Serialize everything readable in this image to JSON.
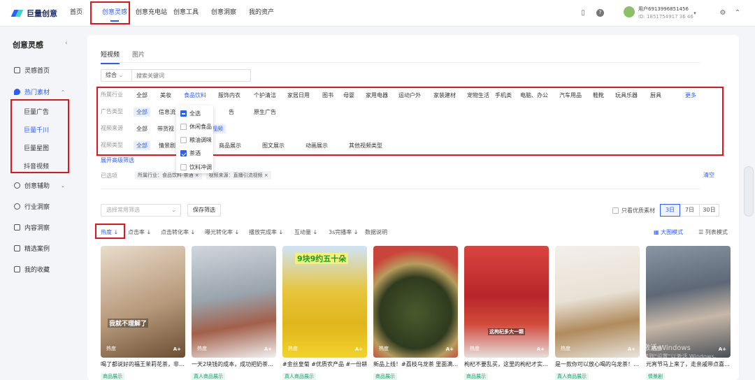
{
  "header": {
    "logo_text": "巨量创意",
    "nav": [
      "首页",
      "创意灵感",
      "创意充电站",
      "创意工具",
      "创意洞察",
      "我的资产"
    ],
    "user_name": "用户6913996851456",
    "user_id": "ID: 1851754917 36 46",
    "icons": [
      "phone-icon",
      "help-icon",
      "settings-icon"
    ]
  },
  "sidebar": {
    "title": "创意灵感",
    "items": [
      "灵感首页",
      "热门素材",
      "创意辅助",
      "行业洞察",
      "内容洞察",
      "精选案例",
      "我的收藏"
    ],
    "sub_items": [
      "巨量广告",
      "巨量千川",
      "巨量星图",
      "抖音视频"
    ]
  },
  "main": {
    "tabs": [
      "短视频",
      "图片"
    ],
    "search_select": "综合",
    "search_placeholder": "搜索关键词",
    "filters": {
      "industry_label": "所属行业",
      "industry": [
        "全部",
        "美妆",
        "食品饮料",
        "服饰内衣",
        "个护清洁",
        "家居日用",
        "图书",
        "母婴",
        "家用电器",
        "运动户外",
        "家装建材",
        "宠物生活",
        "手机类",
        "电脑、办公",
        "汽车用品",
        "鞋靴",
        "玩具乐器",
        "厨具",
        "更多"
      ],
      "adtype_label": "广告类型",
      "adtype": [
        "全部",
        "信息流",
        "告",
        "原生广告"
      ],
      "source_label": "视频来源",
      "source": [
        "全部",
        "带货视",
        "引流视频"
      ],
      "videotype_label": "视频类型",
      "videotype": [
        "全部",
        "情景剧",
        "商品展示",
        "图文展示",
        "动画展示",
        "其他视频类型"
      ]
    },
    "dropdown": [
      "全选",
      "休闲食品",
      "粮油调味",
      "茶酒",
      "饮料冲调"
    ],
    "expand_link": "展开高级筛选",
    "selected_label": "已选项",
    "selected_tags": [
      "所属行业：食品饮料-茶酒 ×",
      "视频来源：直播引流视频 ×"
    ],
    "clear": "清空",
    "common_filter_placeholder": "选择常用筛选",
    "save_filter": "保存筛选",
    "quality_only": "只看优质素材",
    "days": [
      "3日",
      "7日",
      "30日"
    ],
    "sorts": [
      "热度 ↓",
      "点击率 ↓",
      "点击转化率 ↓",
      "曝光转化率 ↓",
      "播放完成率 ↓",
      "互动量 ↓",
      "3s完播率 ↓",
      "数据说明"
    ],
    "modes": [
      "大图模式",
      "列表模式"
    ],
    "cards": [
      {
        "title": "喝了都说好的福王茉莉花茶，非…",
        "tag": "商品展示",
        "caption": "我就不理解了",
        "hot": "热度",
        "badge": "A+"
      },
      {
        "title": "一天2块钱的成本，成功把奶茶…",
        "tag": "真人商品展示",
        "caption": "",
        "hot": "热度",
        "badge": "A+"
      },
      {
        "title": "#金丝皇菊 #优质农产品 #一份耕…",
        "tag": "真人商品展示",
        "caption": "9块9约五十朵",
        "hot": "热度",
        "badge": "A+"
      },
      {
        "title": "新品上线！#荔枝乌龙茶 里面满…",
        "tag": "商品展示",
        "caption": "",
        "hot": "热度",
        "badge": "A+"
      },
      {
        "title": "枸杞不要乱买，这里的枸杞才实…",
        "tag": "商品展示",
        "caption": "这枸杞多大一颗",
        "hot": "热度",
        "badge": "A+"
      },
      {
        "title": "是一款你可以放心喝的乌龙茶！…",
        "tag": "真人商品展示",
        "caption": "",
        "hot": "热度",
        "badge": "A+"
      },
      {
        "title": "元宵节马上来了，走亲戚带点喜…",
        "tag": "情景剧",
        "caption": "",
        "hot": "热度",
        "badge": "A+"
      }
    ],
    "watermark": [
      "激活 Windows",
      "转到\"设置\"以激活 Windows。"
    ]
  }
}
